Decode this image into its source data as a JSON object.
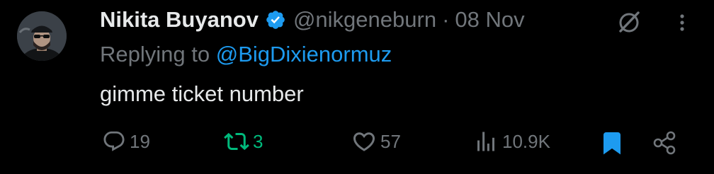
{
  "tweet": {
    "author_name": "Nikita Buyanov",
    "handle": "@nikgeneburn",
    "separator": "·",
    "date": "08 Nov",
    "reply_prefix": "Replying to",
    "reply_to": "@BigDixienormuz",
    "text": "gimme ticket number"
  },
  "actions": {
    "replies": "19",
    "retweets": "3",
    "likes": "57",
    "views": "10.9K",
    "bookmarked": true
  },
  "icons": {
    "verified": "verified-badge-icon",
    "grok": "grok-icon",
    "more": "more-icon",
    "reply": "reply-icon",
    "retweet": "retweet-icon",
    "like": "heart-icon",
    "views": "views-icon",
    "bookmark": "bookmark-icon",
    "share": "share-icon"
  },
  "colors": {
    "background": "#000000",
    "primary_text": "#e7e9ea",
    "secondary_text": "#71767b",
    "accent_blue": "#1d9bf0",
    "retweet_green": "#00ba7c"
  }
}
